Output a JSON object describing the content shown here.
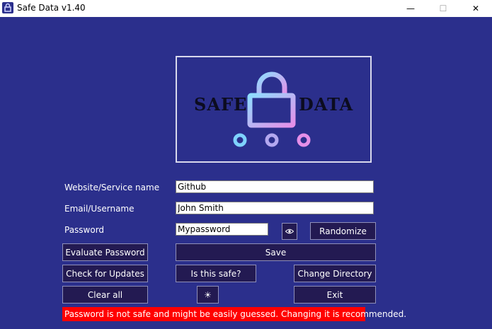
{
  "window": {
    "title": "Safe Data v1.40",
    "controls": {
      "minimize": "—",
      "maximize": "☐",
      "close": "✕"
    },
    "app_icon": "lock-icon"
  },
  "logo": {
    "word_left": "SAFE",
    "word_right": "DATA",
    "icon": "lock-network-icon",
    "colors": {
      "gradient_start": "#7fd3ff",
      "gradient_end": "#e58fe8"
    }
  },
  "form": {
    "website_label": "Website/Service name",
    "website_value": "Github",
    "email_label": "Email/Username",
    "email_value": "John Smith",
    "password_label": "Password",
    "password_value": "Mypassword",
    "show_password_icon": "eye-icon"
  },
  "buttons": {
    "randomize": "Randomize",
    "evaluate": "Evaluate Password",
    "save": "Save",
    "check_updates": "Check for Updates",
    "is_safe": "Is this safe?",
    "change_directory": "Change Directory",
    "clear_all": "Clear all",
    "theme_icon": "sun-icon",
    "theme_glyph": "☀",
    "exit": "Exit"
  },
  "status": {
    "message": "Password is not safe and might be easily guessed. Changing it is recommended.",
    "color": "#ff0000"
  },
  "colors": {
    "background": "#2b2f8c",
    "button": "#231a52",
    "text": "#ffffff"
  }
}
